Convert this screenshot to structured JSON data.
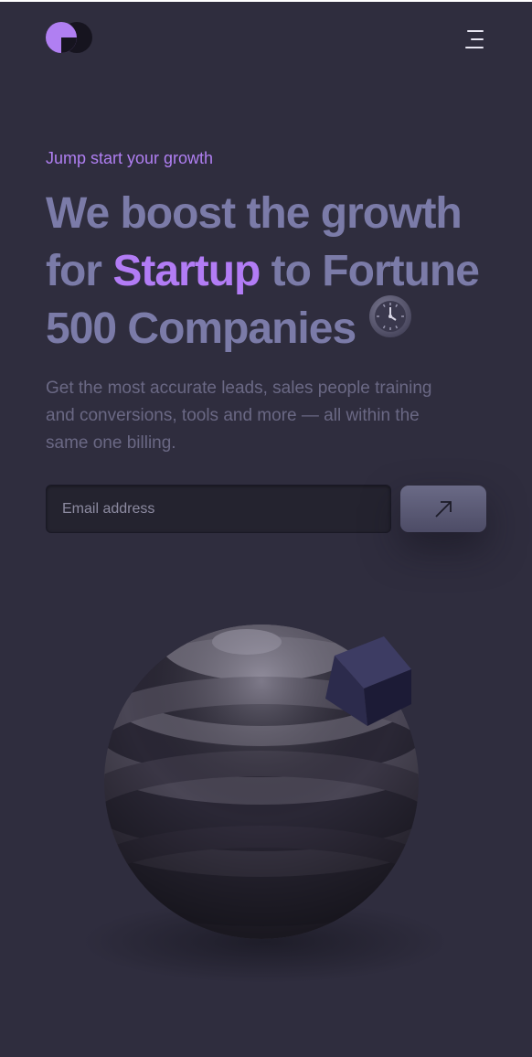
{
  "header": {
    "logo_icon": "logo-icon",
    "menu_icon": "hamburger-menu-icon"
  },
  "hero": {
    "eyebrow": "Jump start your growth",
    "headline_part1": "We boost the growth for ",
    "headline_accent": "Startup",
    "headline_part2": " to Fortune 500 Companies",
    "headline_icon": "clock-icon",
    "description": "Get the most accurate leads, sales people training and conversions, tools and more — all within the same one billing."
  },
  "signup": {
    "email_placeholder": "Email address",
    "email_value": "",
    "submit_icon": "arrow-up-right-icon"
  },
  "illustration": {
    "icon": "striped-sphere-with-cube-illustration"
  },
  "colors": {
    "background": "#2f2d3e",
    "accent": "#b27cf5",
    "headline": "#7b7ba8",
    "body_text": "#6a6884"
  }
}
